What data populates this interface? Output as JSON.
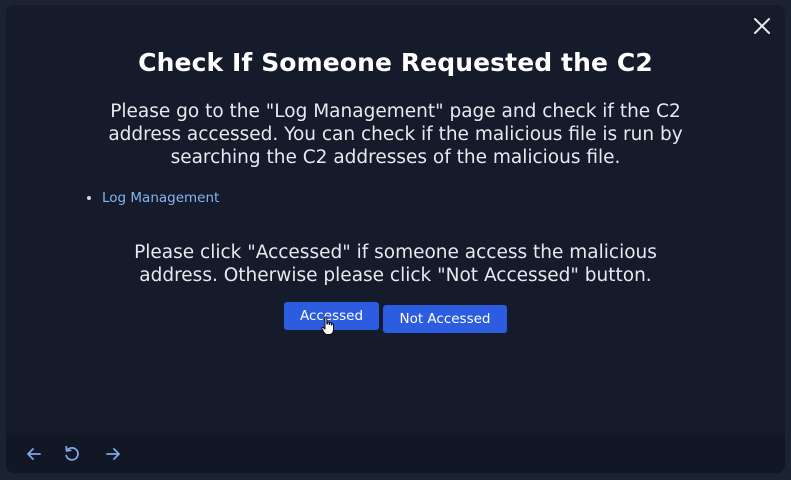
{
  "modal": {
    "title": "Check If Someone Requested the C2",
    "description": "Please go to the \"Log Management\" page and check if the C2 address accessed. You can check if the malicious file is run by searching the C2 addresses of the malicious file.",
    "links": [
      {
        "label": "Log Management"
      }
    ],
    "prompt": "Please click \"Accessed\" if someone access the malicious address. Otherwise please click \"Not Accessed\" button.",
    "buttons": {
      "accessed": "Accessed",
      "not_accessed": "Not Accessed"
    },
    "close_icon": "close-icon"
  },
  "footer": {
    "icons": [
      "arrow-left-icon",
      "reload-icon",
      "arrow-right-icon"
    ]
  },
  "colors": {
    "background": "#151b2a",
    "button": "#2c5ce0",
    "link": "#86b3f2",
    "text": "#ffffff"
  }
}
